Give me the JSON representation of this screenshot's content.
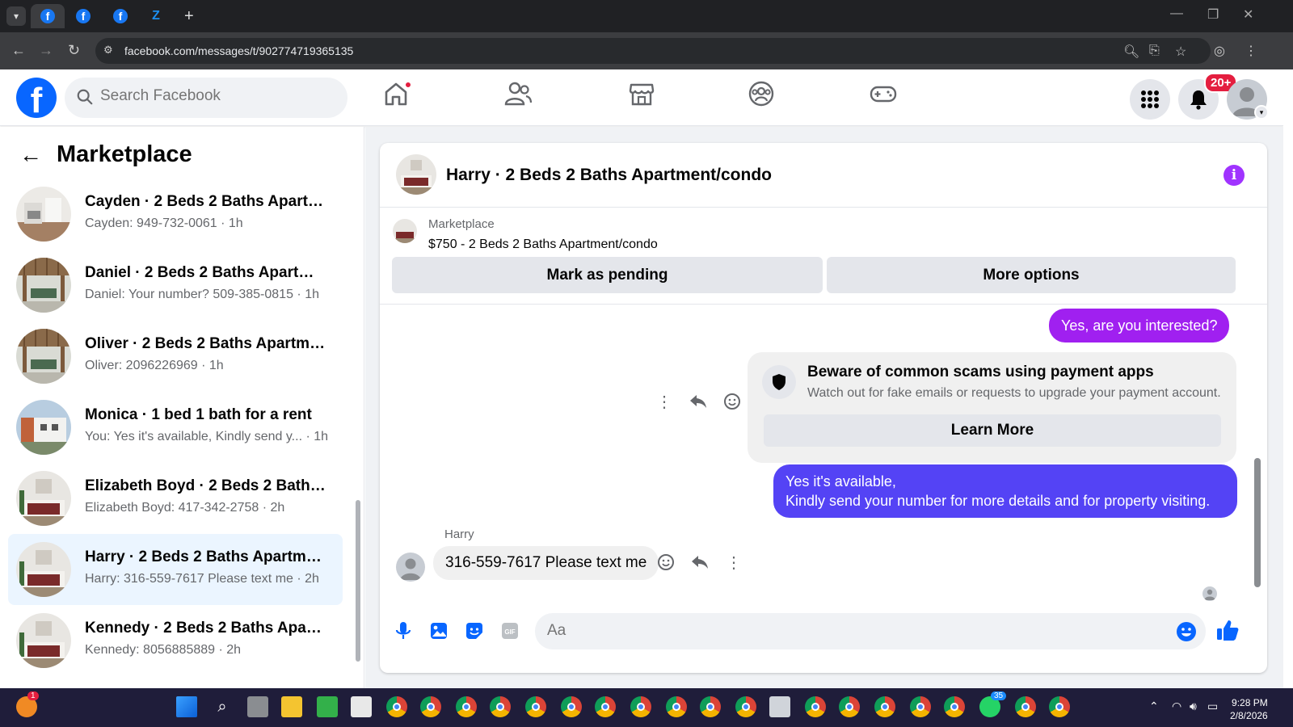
{
  "browser": {
    "url": "facebook.com/messages/t/902774719365135"
  },
  "header": {
    "search_placeholder": "Search Facebook",
    "notification_badge": "20+"
  },
  "sidebar": {
    "title": "Marketplace",
    "conversations": [
      {
        "title": "Cayden · 2 Beds 2 Baths Apartm...",
        "subtitle": "Cayden: 949-732-0061 · 1h",
        "active": false
      },
      {
        "title": "Daniel · 2 Beds 2 Baths Apartme...",
        "subtitle": "Daniel: Your number? 509-385-0815 · 1h",
        "active": false
      },
      {
        "title": "Oliver · 2 Beds 2 Baths Apartmen...",
        "subtitle": "Oliver: 2096226969 · 1h",
        "active": false
      },
      {
        "title": "Monica · 1 bed 1 bath for a rent",
        "subtitle": "You: Yes it's available, Kindly send y...  · 1h",
        "active": false
      },
      {
        "title": "Elizabeth Boyd · 2 Beds 2 Baths ...",
        "subtitle": "Elizabeth Boyd: 417-342-2758 · 2h",
        "active": false
      },
      {
        "title": "Harry · 2 Beds 2 Baths Apartmen...",
        "subtitle": "Harry: 316-559-7617 Please text me · 2h",
        "active": true
      },
      {
        "title": "Kennedy · 2 Beds 2 Baths Apart...",
        "subtitle": "Kennedy: 8056885889 · 2h",
        "active": false
      }
    ]
  },
  "chat": {
    "title": "Harry · 2 Beds 2 Baths Apartment/condo",
    "marketplace": {
      "label": "Marketplace",
      "description": "$750 - 2 Beds 2 Baths Apartment/condo",
      "mark_pending": "Mark as pending",
      "more_options": "More options"
    },
    "messages": {
      "out1": "Yes, are you interested?",
      "scam_title": "Beware of common scams using payment apps",
      "scam_desc": "Watch out for fake emails or requests to upgrade your payment account.",
      "learn_more": "Learn More",
      "out2_line1": "Yes it's available,",
      "out2_line2": "Kindly send your number for more details and for property visiting.",
      "sender": "Harry",
      "in1": "316-559-7617 Please text me"
    },
    "composer_placeholder": "Aa"
  },
  "taskbar": {
    "time": "9:28 PM",
    "date": "2/8/2026",
    "whatsapp_badge": "35",
    "firefox_badge": "1"
  },
  "colors": {
    "fb_blue": "#0866ff",
    "outgoing_purple": "#a020f0",
    "outgoing_blue": "#5443f5",
    "info_purple": "#a033ff"
  }
}
